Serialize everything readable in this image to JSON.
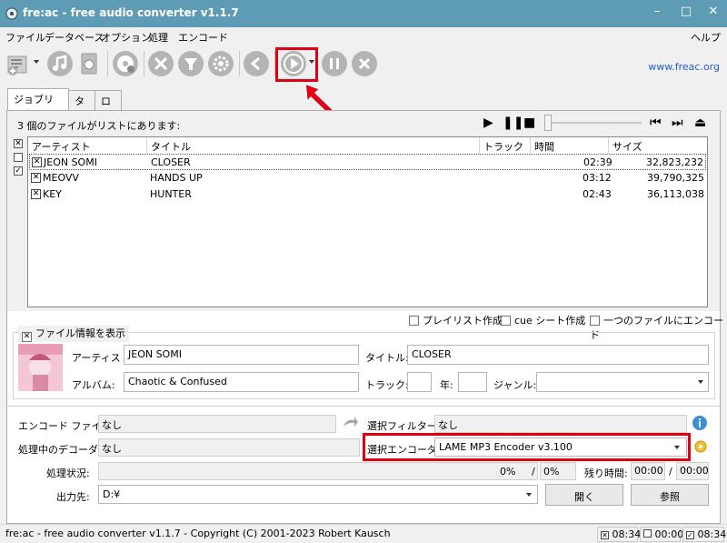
{
  "window": {
    "title": "fre:ac - free audio converter v1.1.7",
    "controls": {
      "minimize": "–",
      "maximize": "□",
      "close": "✕"
    }
  },
  "menu": {
    "items": [
      "ファイル",
      "データベース",
      "オプション",
      "処理",
      "エンコード"
    ],
    "help": "ヘルプ"
  },
  "toolbar": {
    "link": "www.freac.org",
    "icons": [
      "add-files-icon",
      "cd-audio-icon",
      "scan-cd-icon",
      "cddb-query-icon",
      "tools-icon",
      "filter-icon",
      "settings-icon",
      "previous-icon",
      "start-encoding-icon",
      "pause-encoding-icon",
      "stop-encoding-icon"
    ]
  },
  "tabs": [
    "ジョブリスト",
    "タグ",
    "ログ"
  ],
  "joblist": {
    "summary": "3 個のファイルがリストにあります:",
    "columns": [
      "アーティスト",
      "タイトル",
      "トラック",
      "時間",
      "サイズ"
    ],
    "rows": [
      {
        "artist": "JEON SOMI",
        "title": "CLOSER",
        "track": "",
        "time": "02:39",
        "size": "32,823,232"
      },
      {
        "artist": "MEOVV",
        "title": "HANDS UP",
        "track": "",
        "time": "03:12",
        "size": "39,790,325"
      },
      {
        "artist": "KEY",
        "title": "HUNTER",
        "track": "",
        "time": "02:43",
        "size": "36,113,038"
      }
    ]
  },
  "options": {
    "playlist": "プレイリスト作成",
    "cuesheet": "cue シート作成",
    "single_file": "一つのファイルにエンコード"
  },
  "info": {
    "toggle_label": "ファイル情報を表示",
    "artist_label": "アーティスト:",
    "artist_value": "JEON SOMI",
    "title_label": "タイトル:",
    "title_value": "CLOSER",
    "album_label": "アルバム:",
    "album_value": "Chaotic & Confused",
    "track_label": "トラック:",
    "year_label": "年:",
    "genre_label": "ジャンル:",
    "genre_value": ""
  },
  "encode": {
    "file_label": "エンコード ファイル:",
    "file_value": "なし",
    "filter_label": "選択フィルター:",
    "filter_value": "なし",
    "decoder_label": "処理中のデコーダ:",
    "decoder_value": "なし",
    "encoder_label": "選択エンコーダ:",
    "encoder_value": "LAME MP3 Encoder v3.100",
    "progress_label": "処理状況:",
    "progress_file": "0%",
    "progress_total": "0%",
    "progress_slash": "/",
    "remaining_label": "残り時間:",
    "remaining_file": "00:00",
    "remaining_slash": "/",
    "remaining_total": "00:00",
    "output_label": "出力先:",
    "output_value": "D:¥",
    "open_button": "開く",
    "browse_button": "参照"
  },
  "status": {
    "text": "fre:ac - free audio converter v1.1.7 - Copyright (C) 2001-2023 Robert Kausch",
    "selected_time": "08:34",
    "unchecked_time": "00:00",
    "checked_time": "08:34"
  },
  "colors": {
    "titlebar": "#5e9bb4",
    "highlight": "#e00012",
    "link": "#1f5fcf"
  }
}
